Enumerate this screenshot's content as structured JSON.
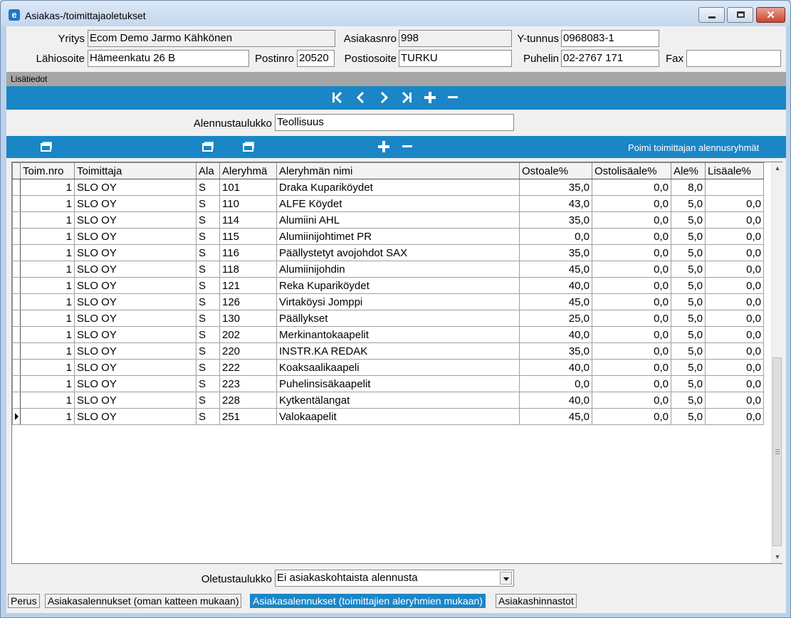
{
  "window": {
    "title": "Asiakas-/toimittajaoletukset",
    "app_icon": "e"
  },
  "header": {
    "yritys_label": "Yritys",
    "yritys_value": "Ecom Demo Jarmo Kähkönen",
    "asiakasnro_label": "Asiakasnro",
    "asiakasnro_value": "998",
    "ytunnus_label": "Y-tunnus",
    "ytunnus_value": "0968083-1",
    "lahiosoite_label": "Lähiosoite",
    "lahiosoite_value": "Hämeenkatu 26 B",
    "postinro_label": "Postinro",
    "postinro_value": "20520",
    "postiosoite_label": "Postiosoite",
    "postiosoite_value": "TURKU",
    "puhelin_label": "Puhelin",
    "puhelin_value": "02-2767 171",
    "fax_label": "Fax",
    "fax_value": ""
  },
  "lisatiedot": "Lisätiedot",
  "nav": {
    "first": "K",
    "prev": "❮",
    "next": "❯",
    "last": "K",
    "add": "+",
    "remove": "−"
  },
  "alennustaulukko": {
    "label": "Alennustaulukko",
    "value": "Teollisuus"
  },
  "grid_toolbar": {
    "add": "+",
    "remove": "−",
    "pick_label": "Poimi toimittajan alennusryhmät"
  },
  "grid": {
    "columns": [
      "Toim.nro",
      "Toimittaja",
      "Ala",
      "Aleryhmä",
      "Aleryhmän nimi",
      "Ostoale%",
      "Ostolisäale%",
      "Ale%",
      "Lisäale%"
    ],
    "rows": [
      [
        "1",
        "SLO OY",
        "S",
        "101",
        "Draka Kupariköydet",
        "35,0",
        "0,0",
        "8,0",
        ""
      ],
      [
        "1",
        "SLO OY",
        "S",
        "110",
        "ALFE Köydet",
        "43,0",
        "0,0",
        "5,0",
        "0,0"
      ],
      [
        "1",
        "SLO OY",
        "S",
        "114",
        "Alumiini AHL",
        "35,0",
        "0,0",
        "5,0",
        "0,0"
      ],
      [
        "1",
        "SLO OY",
        "S",
        "115",
        "Alumiinijohtimet PR",
        "0,0",
        "0,0",
        "5,0",
        "0,0"
      ],
      [
        "1",
        "SLO OY",
        "S",
        "116",
        "Päällystetyt avojohdot SAX",
        "35,0",
        "0,0",
        "5,0",
        "0,0"
      ],
      [
        "1",
        "SLO OY",
        "S",
        "118",
        "Alumiinijohdin",
        "45,0",
        "0,0",
        "5,0",
        "0,0"
      ],
      [
        "1",
        "SLO OY",
        "S",
        "121",
        "Reka Kupariköydet",
        "40,0",
        "0,0",
        "5,0",
        "0,0"
      ],
      [
        "1",
        "SLO OY",
        "S",
        "126",
        "Virtaköysi Jomppi",
        "45,0",
        "0,0",
        "5,0",
        "0,0"
      ],
      [
        "1",
        "SLO OY",
        "S",
        "130",
        "Päällykset",
        "25,0",
        "0,0",
        "5,0",
        "0,0"
      ],
      [
        "1",
        "SLO OY",
        "S",
        "202",
        "Merkinantokaapelit",
        "40,0",
        "0,0",
        "5,0",
        "0,0"
      ],
      [
        "1",
        "SLO OY",
        "S",
        "220",
        "INSTR.KA REDAK",
        "35,0",
        "0,0",
        "5,0",
        "0,0"
      ],
      [
        "1",
        "SLO OY",
        "S",
        "222",
        "Koaksaalikaapeli",
        "40,0",
        "0,0",
        "5,0",
        "0,0"
      ],
      [
        "1",
        "SLO OY",
        "S",
        "223",
        "Puhelinsisäkaapelit",
        "0,0",
        "0,0",
        "5,0",
        "0,0"
      ],
      [
        "1",
        "SLO OY",
        "S",
        "228",
        "Kytkentälangat",
        "40,0",
        "0,0",
        "5,0",
        "0,0"
      ],
      [
        "1",
        "SLO OY",
        "S",
        "251",
        "Valokaapelit",
        "45,0",
        "0,0",
        "5,0",
        "0,0"
      ]
    ],
    "selected_row": 14
  },
  "oletustaulukko": {
    "label": "Oletustaulukko",
    "value": "Ei asiakaskohtaista alennusta"
  },
  "tabs": [
    {
      "label": "Perus",
      "active": false
    },
    {
      "label": "Asiakasalennukset (oman katteen mukaan)",
      "active": false
    },
    {
      "label": "Asiakasalennukset (toimittajien aleryhmien mukaan)",
      "active": true
    },
    {
      "label": "Asiakashinnastot",
      "active": false
    }
  ],
  "colors": {
    "accent": "#1a86c6",
    "section_bar": "#a5a5a5",
    "background": "#f0f0f0"
  }
}
